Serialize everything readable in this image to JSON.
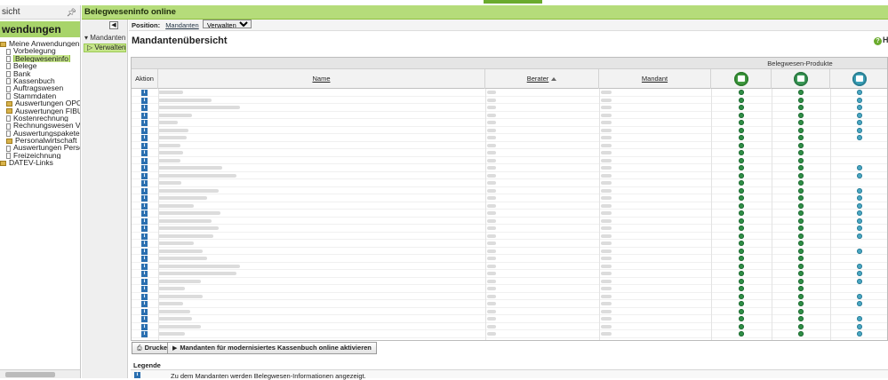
{
  "left_panel": {
    "header": "sicht",
    "app_title": "wendungen",
    "tree": [
      {
        "label": "Meine Anwendungen",
        "level": 1,
        "type": "folder"
      },
      {
        "label": "Vorbelegung",
        "level": 2,
        "type": "doc"
      },
      {
        "label": "Belegweseninfo",
        "level": 2,
        "type": "doc",
        "selected": true
      },
      {
        "label": "Belege",
        "level": 2,
        "type": "doc"
      },
      {
        "label": "Bank",
        "level": 2,
        "type": "doc"
      },
      {
        "label": "Kassenbuch",
        "level": 2,
        "type": "doc"
      },
      {
        "label": "Auftragswesen",
        "level": 2,
        "type": "doc"
      },
      {
        "label": "Stammdaten",
        "level": 2,
        "type": "doc"
      },
      {
        "label": "Auswertungen OPOS",
        "level": 2,
        "type": "folder"
      },
      {
        "label": "Auswertungen FIBU",
        "level": 2,
        "type": "folder"
      },
      {
        "label": "Kostenrechnung",
        "level": 2,
        "type": "doc"
      },
      {
        "label": "Rechnungswesen Vorerfass",
        "level": 2,
        "type": "doc"
      },
      {
        "label": "Auswertungspakete Rechnu",
        "level": 2,
        "type": "doc"
      },
      {
        "label": "Personalwirtschaft",
        "level": 2,
        "type": "folder"
      },
      {
        "label": "Auswertungen Personalwir",
        "level": 2,
        "type": "doc"
      },
      {
        "label": "Freizeichnung",
        "level": 2,
        "type": "doc"
      },
      {
        "label": "DATEV-Links",
        "level": 1,
        "type": "folder"
      }
    ]
  },
  "header": {
    "title": "Belegweseninfo online"
  },
  "nav2": {
    "group": "Mandanten",
    "item": "Verwalten"
  },
  "position": {
    "label": "Position:",
    "crumb": "Mandanten",
    "select_value": "Verwalten"
  },
  "page": {
    "title": "Mandantenübersicht",
    "help": "H"
  },
  "table": {
    "super_header": "Belegwesen-Produkte",
    "columns": {
      "aktion": "Aktion",
      "name": "Name",
      "berater": "Berater",
      "mandant": "Mandant"
    },
    "rows": [
      {
        "p1": true,
        "p2": true,
        "p3": true
      },
      {
        "p1": true,
        "p2": true,
        "p3": true
      },
      {
        "p1": true,
        "p2": true,
        "p3": true
      },
      {
        "p1": true,
        "p2": true,
        "p3": true
      },
      {
        "p1": true,
        "p2": true,
        "p3": true
      },
      {
        "p1": true,
        "p2": true,
        "p3": true
      },
      {
        "p1": true,
        "p2": true,
        "p3": true
      },
      {
        "p1": true,
        "p2": true,
        "p3": false
      },
      {
        "p1": true,
        "p2": true,
        "p3": false
      },
      {
        "p1": true,
        "p2": true,
        "p3": false
      },
      {
        "p1": true,
        "p2": true,
        "p3": true
      },
      {
        "p1": true,
        "p2": true,
        "p3": true
      },
      {
        "p1": true,
        "p2": true,
        "p3": false
      },
      {
        "p1": true,
        "p2": true,
        "p3": true
      },
      {
        "p1": true,
        "p2": true,
        "p3": true
      },
      {
        "p1": true,
        "p2": true,
        "p3": true
      },
      {
        "p1": true,
        "p2": true,
        "p3": true
      },
      {
        "p1": true,
        "p2": true,
        "p3": true
      },
      {
        "p1": true,
        "p2": true,
        "p3": true
      },
      {
        "p1": true,
        "p2": true,
        "p3": true
      },
      {
        "p1": true,
        "p2": true,
        "p3": false
      },
      {
        "p1": true,
        "p2": true,
        "p3": true
      },
      {
        "p1": true,
        "p2": true,
        "p3": false
      },
      {
        "p1": true,
        "p2": true,
        "p3": true
      },
      {
        "p1": true,
        "p2": true,
        "p3": true
      },
      {
        "p1": true,
        "p2": true,
        "p3": true
      },
      {
        "p1": true,
        "p2": true,
        "p3": false
      },
      {
        "p1": true,
        "p2": true,
        "p3": true
      },
      {
        "p1": true,
        "p2": true,
        "p3": true
      },
      {
        "p1": true,
        "p2": true,
        "p3": false
      },
      {
        "p1": true,
        "p2": true,
        "p3": true
      },
      {
        "p1": true,
        "p2": true,
        "p3": true
      },
      {
        "p1": true,
        "p2": true,
        "p3": true
      }
    ]
  },
  "buttons": {
    "print": "Drucken",
    "activate": "Mandanten für modernisiertes Kassenbuch online aktivieren"
  },
  "legend": {
    "title": "Legende",
    "info_text": "Zu dem Mandanten werden Belegwesen-Informationen angezeigt."
  },
  "colors": {
    "accent_green": "#b5dc7a",
    "selection_green": "#c6e58a",
    "info_blue": "#2a6fb0",
    "dot_green": "#2f8f46",
    "dot_teal": "#4aa7c3"
  }
}
